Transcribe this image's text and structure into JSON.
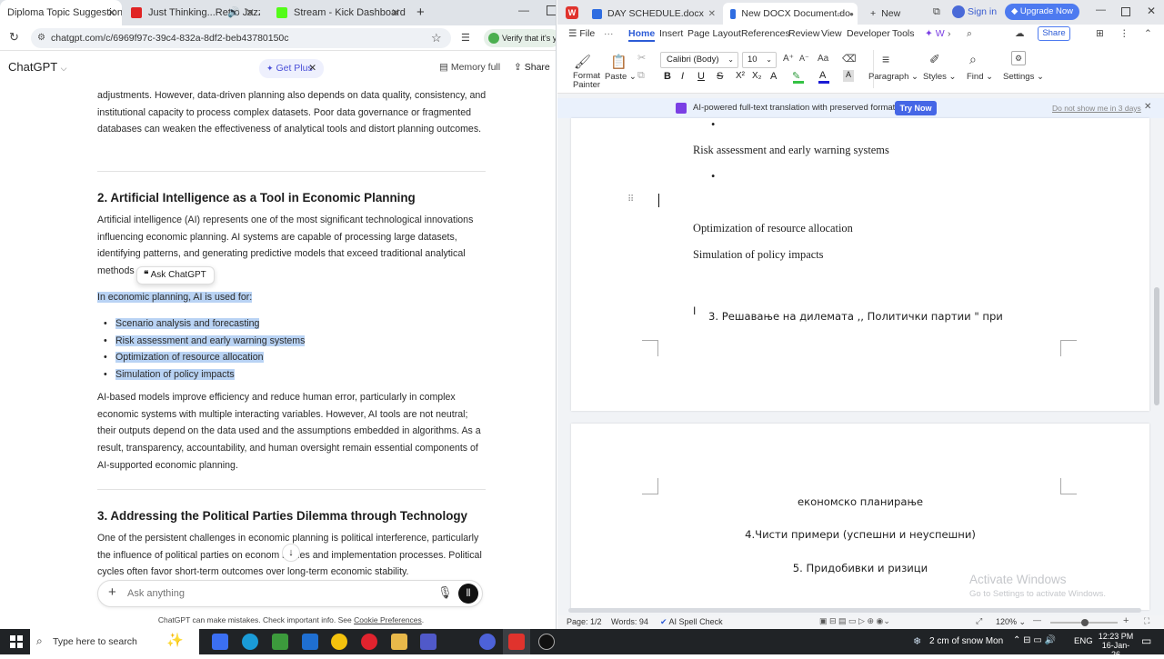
{
  "browser": {
    "tabs": [
      {
        "title": "Diploma Topic Suggestions",
        "active": true
      },
      {
        "title": "Just Thinking...Retro Jazz - ",
        "active": false
      },
      {
        "title": "Stream - Kick Dashboard",
        "active": false
      }
    ],
    "url": "chatgpt.com/c/6969f97c-39c4-832a-8df2-beb43780150c",
    "extension_text": "Verify that it's you"
  },
  "chatgpt": {
    "model_label": "ChatGPT",
    "get_plus": "Get Plus",
    "memory": "Memory full",
    "share": "Share",
    "para_intro": "adjustments. However, data-driven planning also depends on data quality, consistency, and institutional capacity to process complex datasets. Poor data governance or fragmented databases can weaken the effectiveness of analytical tools and distort planning outcomes.",
    "h2_ai": "2. Artificial Intelligence as a Tool in Economic Planning",
    "para_ai": "Artificial intelligence (AI) represents one of the most significant technological innovations influencing economic planning. AI systems are capable of processing large datasets, identifying patterns, and generating predictive models that exceed traditional analytical methods",
    "ask_chatgpt": "Ask ChatGPT",
    "used_for": "In economic planning, AI is used for:",
    "bullets": [
      "Scenario analysis and forecasting",
      "Risk assessment and early warning systems",
      "Optimization of resource allocation",
      "Simulation of policy impacts"
    ],
    "para_models": "AI-based models improve efficiency and reduce human error, particularly in complex economic systems with multiple interacting variables. However, AI tools are not neutral; their outputs depend on the data used and the assumptions embedded in algorithms. As a result, transparency, accountability, and human oversight remain essential components of AI-supported economic planning.",
    "h2_pol": "3. Addressing the Political Parties Dilemma through Technology",
    "para_pol": "One of the persistent challenges in economic planning is political interference, particularly the influence of political parties on econom    iorities and implementation processes. Political cycles often favor short-term outcomes over long-term economic stability.",
    "ask_placeholder": "Ask anything",
    "disclaimer": "ChatGPT can make mistakes. Check important info. See ",
    "cookie_link": "Cookie Preferences",
    "disclaimer_end": "."
  },
  "wps": {
    "tabs": [
      {
        "title": "DAY SCHEDULE.docx"
      },
      {
        "title": "New DOCX Document.do"
      },
      {
        "title": "New"
      }
    ],
    "sign_in": "Sign in",
    "upgrade": "Upgrade Now",
    "menu": [
      "File",
      "Home",
      "Insert",
      "Page Layout",
      "References",
      "Review",
      "View",
      "Developer",
      "Tools",
      "W"
    ],
    "share": "Share",
    "ribbon": {
      "format_painter": "Format Painter",
      "paste": "Paste",
      "font": "Calibri (Body)",
      "size": "10",
      "paragraph": "Paragraph",
      "styles": "Styles",
      "find": "Find",
      "settings": "Settings"
    },
    "banner": {
      "text": "AI-powered full-text translation with preserved formatting.",
      "try": "Try Now",
      "dismiss": "Do not show me in 3 days"
    },
    "page1": {
      "risk": "Risk assessment and early warning systems",
      "optimization": "Optimization of resource allocation",
      "simulation": "Simulation of policy impacts",
      "heading3": "3. Решавање на дилемата ,, Политички партии \" при"
    },
    "page2": {
      "line1": "економско планирање",
      "line2": "4.Чисти примери (успешни и неуспешни)",
      "line3": "5. Придобивки и ризици"
    },
    "watermark": {
      "title": "Activate Windows",
      "sub": "Go to Settings to activate Windows."
    },
    "status": {
      "page": "Page: 1/2",
      "words": "Words: 94",
      "spell": "AI Spell Check",
      "zoom": "120%"
    }
  },
  "taskbar": {
    "search": "Type here to search",
    "weather": "2 cm of snow Mon",
    "lang": "ENG",
    "time": "12:23 PM",
    "date": "16-Jan-26"
  }
}
